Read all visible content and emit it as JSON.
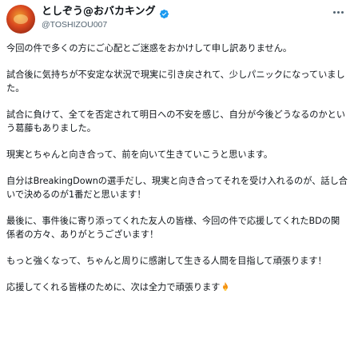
{
  "post": {
    "author": {
      "display_name": "としぞう@おバカキング",
      "handle": "@TOSHIZOU007",
      "verified_badge_color": "#1d9bf0",
      "avatar_icon": "avatar-icon",
      "more_icon": "more-horizontal-icon"
    },
    "paragraphs": [
      {
        "text": "今回の件で多くの方にご心配とご迷惑をおかけして申し訳ありません。"
      },
      {
        "text": "試合後に気持ちが不安定な状況で現実に引き戻されて、少しパニックになっていました。"
      },
      {
        "text": "試合に負けて、全てを否定されて明日への不安を感じ、自分が今後どうなるのかという葛藤もありました。"
      },
      {
        "text": "現実とちゃんと向き合って、前を向いて生きていこうと思います。"
      },
      {
        "text": "自分はBreakingDownの選手だし、現実と向き合ってそれを受け入れるのが、話し合いで決めるのが1番だと思います！"
      },
      {
        "text": "最後に、事件後に寄り添ってくれた友人の皆様、今回の件で応援してくれたBDの関係者の方々、ありがとうございます！"
      },
      {
        "text": "もっと強くなって、ちゃんと周りに感謝して生きる人間を目指して頑張ります！"
      },
      {
        "text": "応援してくれる皆様のために、次は全力で頑張ります",
        "emoji_icon": "fire-icon"
      }
    ]
  }
}
